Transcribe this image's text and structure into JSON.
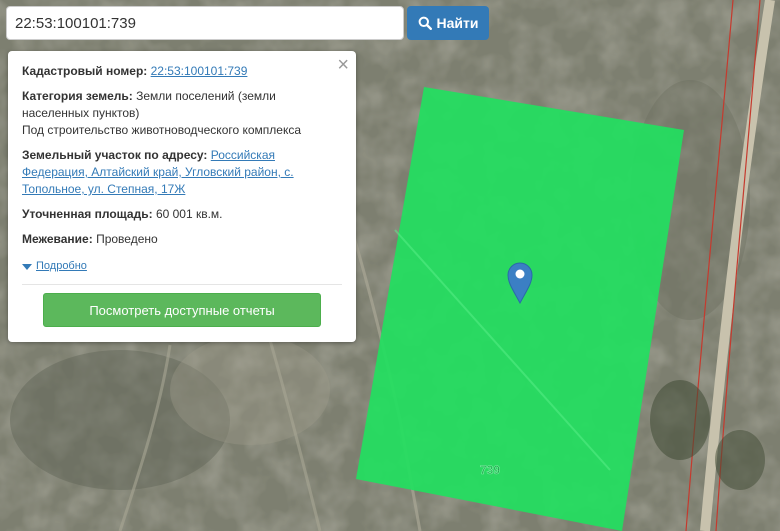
{
  "search": {
    "value": "22:53:100101:739",
    "button_label": "Найти"
  },
  "info": {
    "cadastral_label": "Кадастровый номер:",
    "cadastral_value": "22:53:100101:739",
    "category_label": "Категория земель:",
    "category_value": "Земли поселений (земли населенных пунктов)",
    "purpose": "Под строительство животноводческого комплекса",
    "address_label": "Земельный участок по адресу:",
    "address_value": "Российская Федерация, Алтайский край, Угловский район, с. Топольное, ул. Степная, 17Ж",
    "area_label": "Уточненная площадь:",
    "area_value": "60 001 кв.м.",
    "survey_label": "Межевание:",
    "survey_value": "Проведено",
    "details_label": "Подробно",
    "close_glyph": "×",
    "report_button": "Посмотреть доступные отчеты"
  },
  "map": {
    "parcel_label": "739",
    "parcel_color": "#22e05f"
  }
}
